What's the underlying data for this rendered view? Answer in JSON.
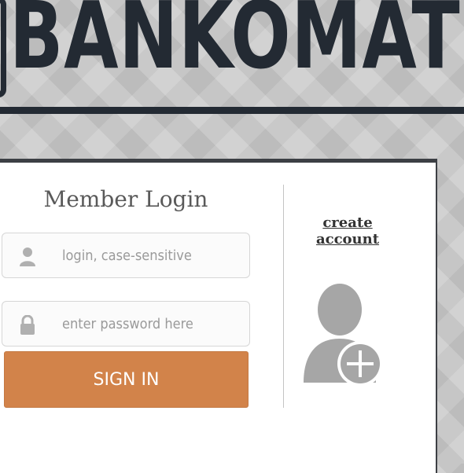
{
  "brand": {
    "title": "BANKOMAT"
  },
  "login": {
    "heading": "Member Login",
    "username_placeholder": "login, case-sensitive",
    "username_value": "",
    "password_placeholder": "enter password here",
    "password_value": "",
    "sign_in_label": "SIGN IN"
  },
  "account": {
    "create_label": "create account"
  },
  "icons": {
    "logo": "logo-bracket-icon",
    "user": "user-icon",
    "lock": "lock-icon",
    "add_user": "add-user-icon"
  },
  "colors": {
    "brand_dark": "#232a33",
    "button": "#d2834a",
    "panel": "#ffffff",
    "icon_gray": "#a6a6a6"
  }
}
